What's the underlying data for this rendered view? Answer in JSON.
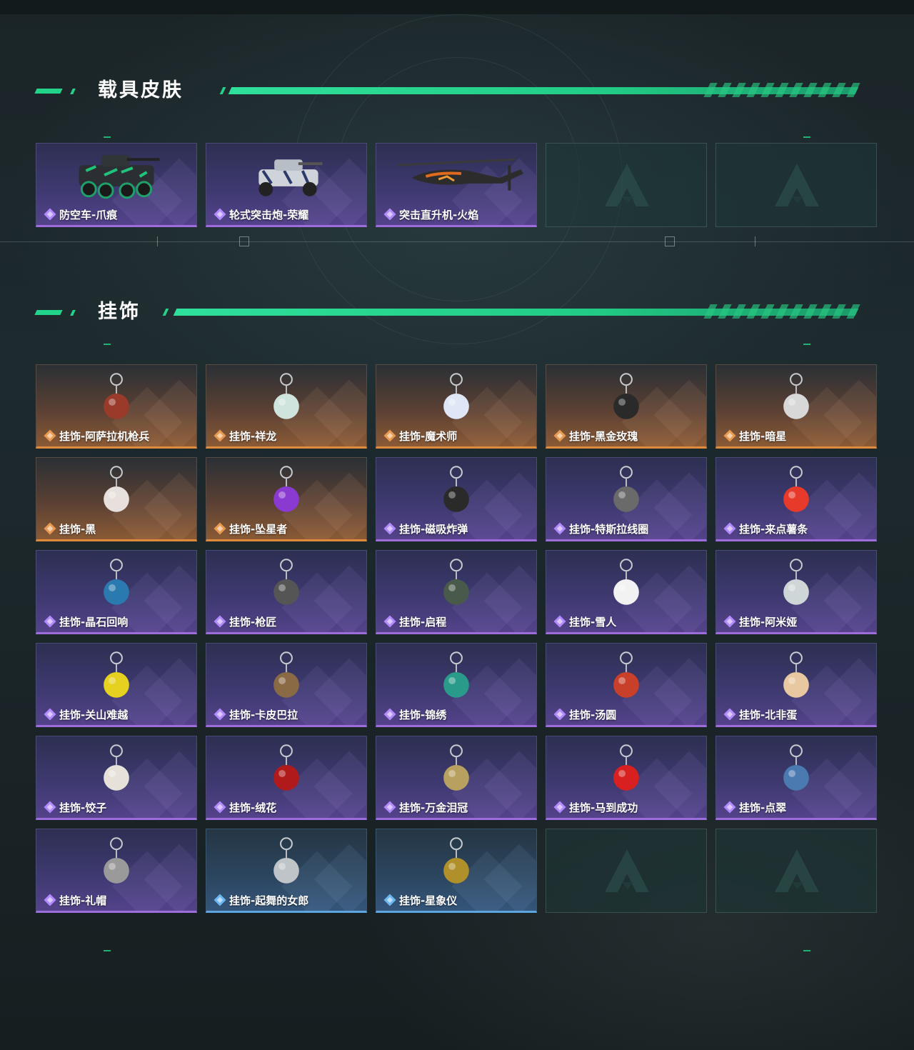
{
  "colors": {
    "accent": "#22d38a",
    "rarity_purple": "#9d6ddc",
    "rarity_orange": "#e08a3c",
    "rarity_blue": "#5ea5e0",
    "background": "#1d2a2e"
  },
  "sections": {
    "vehicle_skins": {
      "title": "载具皮肤",
      "items": [
        {
          "name": "防空车-爪痕",
          "rarity": "purple",
          "icon": "armored-vehicle-icon"
        },
        {
          "name": "轮式突击炮-荣耀",
          "rarity": "purple",
          "icon": "wheeled-assault-gun-icon"
        },
        {
          "name": "突击直升机-火焰",
          "rarity": "purple",
          "icon": "attack-helicopter-icon"
        },
        {
          "name": "",
          "rarity": "empty",
          "icon": "placeholder-logo-icon"
        },
        {
          "name": "",
          "rarity": "empty",
          "icon": "placeholder-logo-icon"
        }
      ]
    },
    "charms": {
      "title": "挂饰",
      "items": [
        {
          "name": "挂饰-阿萨拉机枪兵",
          "rarity": "orange",
          "icon": "gunner-charm-icon"
        },
        {
          "name": "挂饰-祥龙",
          "rarity": "orange",
          "icon": "dragon-charm-icon"
        },
        {
          "name": "挂饰-魔术师",
          "rarity": "orange",
          "icon": "magician-card-charm-icon"
        },
        {
          "name": "挂饰-黑金玫瑰",
          "rarity": "orange",
          "icon": "black-gold-rose-charm-icon"
        },
        {
          "name": "挂饰-暗星",
          "rarity": "orange",
          "icon": "dark-star-charm-icon"
        },
        {
          "name": "挂饰-黑",
          "rarity": "orange",
          "icon": "black-tag-charm-icon"
        },
        {
          "name": "挂饰-坠星者",
          "rarity": "orange",
          "icon": "purple-crystal-charm-icon"
        },
        {
          "name": "挂饰-磁吸炸弹",
          "rarity": "purple",
          "icon": "magnetic-bomb-charm-icon"
        },
        {
          "name": "挂饰-特斯拉线圈",
          "rarity": "purple",
          "icon": "tesla-coil-charm-icon"
        },
        {
          "name": "挂饰-来点薯条",
          "rarity": "purple",
          "icon": "fries-charm-icon"
        },
        {
          "name": "挂饰-晶石回响",
          "rarity": "purple",
          "icon": "crystal-charm-icon"
        },
        {
          "name": "挂饰-枪匠",
          "rarity": "purple",
          "icon": "gunsmith-charm-icon"
        },
        {
          "name": "挂饰-启程",
          "rarity": "purple",
          "icon": "medallion-charm-icon"
        },
        {
          "name": "挂饰-雪人",
          "rarity": "purple",
          "icon": "snowman-charm-icon"
        },
        {
          "name": "挂饰-阿米娅",
          "rarity": "purple",
          "icon": "bunny-charm-icon"
        },
        {
          "name": "挂饰-关山难越",
          "rarity": "purple",
          "icon": "yellow-tube-charm-icon"
        },
        {
          "name": "挂饰-卡皮巴拉",
          "rarity": "purple",
          "icon": "capybara-charm-icon"
        },
        {
          "name": "挂饰-锦绣",
          "rarity": "purple",
          "icon": "butterfly-charm-icon"
        },
        {
          "name": "挂饰-汤圆",
          "rarity": "purple",
          "icon": "tangyuan-bowl-charm-icon"
        },
        {
          "name": "挂饰-北非蛋",
          "rarity": "purple",
          "icon": "shakshuka-charm-icon"
        },
        {
          "name": "挂饰-饺子",
          "rarity": "purple",
          "icon": "dumpling-plate-charm-icon"
        },
        {
          "name": "挂饰-绒花",
          "rarity": "purple",
          "icon": "red-flower-charm-icon"
        },
        {
          "name": "挂饰-万金泪冠",
          "rarity": "purple",
          "icon": "crown-charm-icon"
        },
        {
          "name": "挂饰-马到成功",
          "rarity": "purple",
          "icon": "red-horse-charm-icon"
        },
        {
          "name": "挂饰-点翠",
          "rarity": "purple",
          "icon": "phoenix-hairpin-charm-icon"
        },
        {
          "name": "挂饰-礼帽",
          "rarity": "purple",
          "icon": "fedora-hat-charm-icon"
        },
        {
          "name": "挂饰-起舞的女郎",
          "rarity": "blue",
          "icon": "dancer-statue-charm-icon"
        },
        {
          "name": "挂饰-星象仪",
          "rarity": "blue",
          "icon": "orrery-charm-icon"
        },
        {
          "name": "",
          "rarity": "empty",
          "icon": "placeholder-logo-icon"
        },
        {
          "name": "",
          "rarity": "empty",
          "icon": "placeholder-logo-icon"
        }
      ]
    }
  }
}
